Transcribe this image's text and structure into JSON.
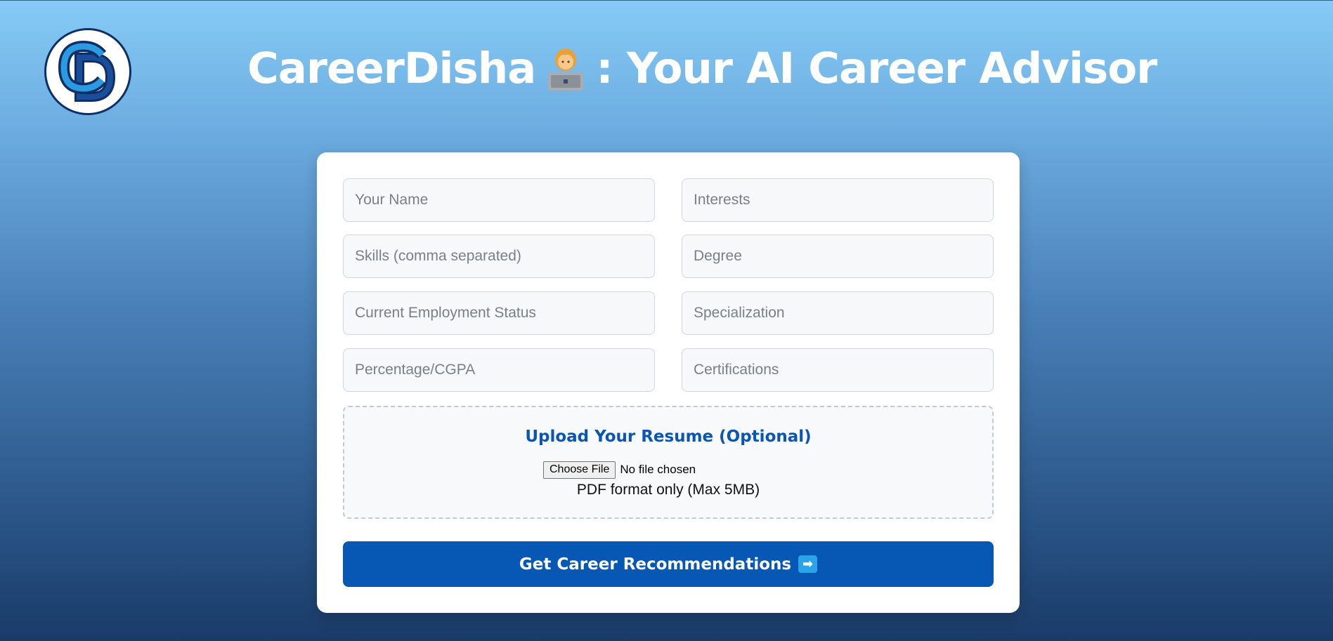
{
  "header": {
    "logo_text": "CD",
    "title_prefix": "CareerDisha",
    "title_emoji_icon": "woman-technologist-icon",
    "title_suffix": ": Your AI Career Advisor"
  },
  "form": {
    "fields": {
      "name": {
        "placeholder": "Your Name",
        "value": ""
      },
      "interests": {
        "placeholder": "Interests",
        "value": ""
      },
      "skills": {
        "placeholder": "Skills (comma separated)",
        "value": ""
      },
      "degree": {
        "placeholder": "Degree",
        "value": ""
      },
      "employment_status": {
        "placeholder": "Current Employment Status",
        "value": ""
      },
      "specialization": {
        "placeholder": "Specialization",
        "value": ""
      },
      "percentage": {
        "placeholder": "Percentage/CGPA",
        "value": ""
      },
      "certifications": {
        "placeholder": "Certifications",
        "value": ""
      }
    },
    "upload": {
      "title": "Upload Your Resume (Optional)",
      "choose_label": "Choose File",
      "status": "No file chosen",
      "note": "PDF format only (Max 5MB)"
    },
    "submit_label": "Get Career Recommendations",
    "submit_icon": "right-arrow-icon"
  },
  "colors": {
    "accent": "#0757b4",
    "upload_title": "#0a56b2",
    "arrow_icon_bg": "#2aa3e8",
    "background_top": "#86cbf7",
    "background_bottom": "#1a3b68"
  }
}
